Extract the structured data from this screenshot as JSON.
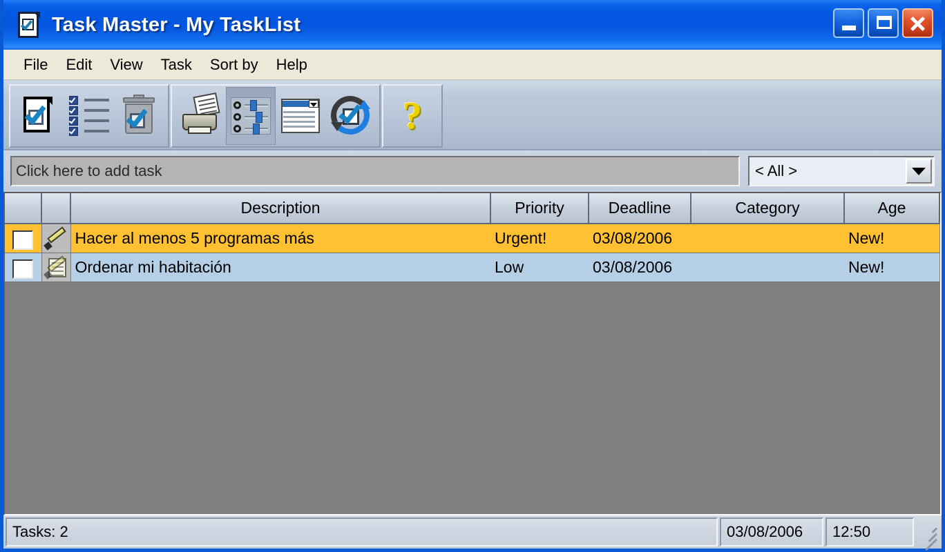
{
  "window": {
    "title": "Task Master - My TaskList",
    "app_icon": "task-document-icon",
    "controls": {
      "minimize": "minimize-button",
      "maximize": "maximize-button",
      "close": "close-button"
    },
    "colors": {
      "titlebar_blue": "#0455df",
      "menubar": "#ece9d8",
      "toolbar": "#b4c1d4",
      "list_background": "#808080",
      "row_urgent": "#ffc132",
      "row_normal": "#b4cfe6",
      "header": "#c5cedb"
    }
  },
  "menu": {
    "items": [
      {
        "label": "File"
      },
      {
        "label": "Edit"
      },
      {
        "label": "View"
      },
      {
        "label": "Task"
      },
      {
        "label": "Sort by"
      },
      {
        "label": "Help"
      }
    ]
  },
  "toolbar": {
    "groups": [
      {
        "buttons": [
          {
            "name": "new-task",
            "icon": "new-task-document-icon",
            "pressed": false
          },
          {
            "name": "task-list",
            "icon": "checklist-icon",
            "pressed": false
          },
          {
            "name": "delete-task",
            "icon": "trash-can-icon",
            "pressed": false
          }
        ]
      },
      {
        "buttons": [
          {
            "name": "print",
            "icon": "printer-icon",
            "pressed": false
          },
          {
            "name": "options",
            "icon": "sliders-options-icon",
            "pressed": true
          },
          {
            "name": "dropdown-view",
            "icon": "dropdown-list-icon",
            "pressed": false
          },
          {
            "name": "refresh",
            "icon": "refresh-check-icon",
            "pressed": false
          }
        ]
      },
      {
        "buttons": [
          {
            "name": "help",
            "icon": "question-mark-icon",
            "pressed": false
          }
        ]
      }
    ]
  },
  "add_row": {
    "add_task_placeholder": "Click here to add task",
    "add_task_value": "",
    "filter": {
      "selected": "< All >",
      "arrow_icon": "chevron-down-icon"
    }
  },
  "table": {
    "columns": [
      {
        "key": "check",
        "label": ""
      },
      {
        "key": "icon",
        "label": ""
      },
      {
        "key": "description",
        "label": "Description"
      },
      {
        "key": "priority",
        "label": "Priority"
      },
      {
        "key": "deadline",
        "label": "Deadline"
      },
      {
        "key": "category",
        "label": "Category"
      },
      {
        "key": "age",
        "label": "Age"
      }
    ],
    "rows": [
      {
        "checked": false,
        "icon": "pencil-icon",
        "description": "Hacer al menos 5 programas más",
        "priority": "Urgent!",
        "deadline": "03/08/2006",
        "category": "",
        "age": "New!",
        "style": "urgent"
      },
      {
        "checked": false,
        "icon": "pencil-note-icon",
        "description": "Ordenar mi habitación",
        "priority": "Low",
        "deadline": "03/08/2006",
        "category": "",
        "age": "New!",
        "style": "normal"
      }
    ]
  },
  "status_bar": {
    "tasks": "Tasks: 2",
    "date": "03/08/2006",
    "time": "12:50",
    "grip_icon": "resize-grip-icon"
  }
}
